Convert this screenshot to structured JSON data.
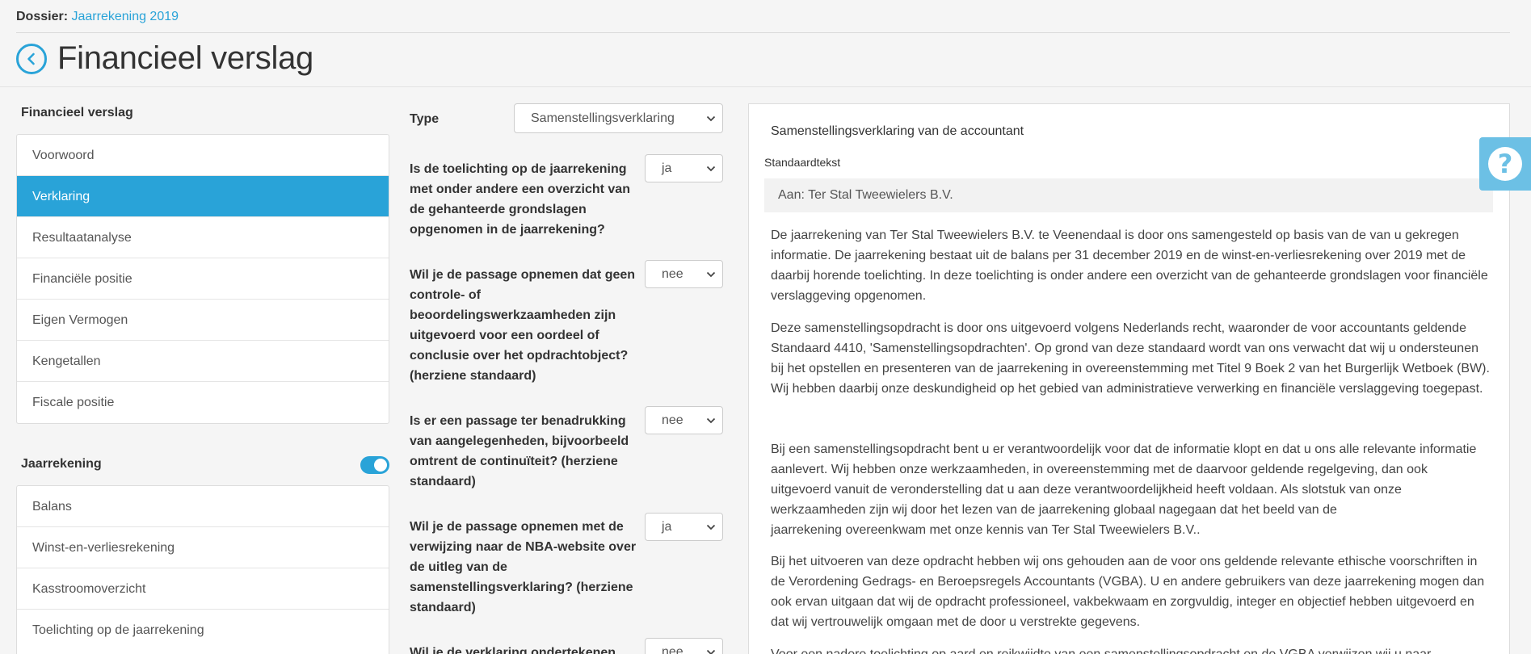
{
  "dossier": {
    "label": "Dossier:",
    "value": "Jaarrekening 2019"
  },
  "page": {
    "title": "Financieel verslag"
  },
  "sidebar": {
    "section1_title": "Financieel verslag",
    "section1_items": [
      {
        "label": "Voorwoord"
      },
      {
        "label": "Verklaring"
      },
      {
        "label": "Resultaatanalyse"
      },
      {
        "label": "Financiële positie"
      },
      {
        "label": "Eigen Vermogen"
      },
      {
        "label": "Kengetallen"
      },
      {
        "label": "Fiscale positie"
      }
    ],
    "section2_title": "Jaarrekening",
    "section2_items": [
      {
        "label": "Balans"
      },
      {
        "label": "Winst-en-verliesrekening"
      },
      {
        "label": "Kasstroomoverzicht"
      },
      {
        "label": "Toelichting op de jaarrekening"
      }
    ]
  },
  "form": {
    "type_label": "Type",
    "type_value": "Samenstellingsverklaring",
    "q1_label": "Is de toelichting op de jaarrekening met onder andere een overzicht van de gehanteerde grondslagen opgenomen in de jaarrekening?",
    "q1_value": "ja",
    "q2_label": "Wil je de passage opnemen dat geen controle- of beoordelingswerkzaamheden zijn uitgevoerd voor een oordeel of conclusie over het opdrachtobject? (herziene standaard)",
    "q2_value": "nee",
    "q3_label": "Is er een passage ter benadrukking van aangelegenheden, bijvoorbeeld omtrent de continuïteit? (herziene standaard)",
    "q3_value": "nee",
    "q4_label": "Wil je de passage opnemen met de verwijzing naar de NBA-website over de uitleg van de samenstellingsverklaring? (herziene standaard)",
    "q4_value": "ja",
    "q5_label": "Wil je de verklaring ondertekenen",
    "q5_value": "nee"
  },
  "panel": {
    "title": "Samenstellingsverklaring van de accountant",
    "std_label": "Standaardtekst",
    "aan": "Aan: Ter Stal Tweewielers B.V.",
    "p1": "De jaarrekening van Ter Stal Tweewielers B.V. te Veenendaal is door ons samengesteld op basis van de van u gekregen informatie. De jaarrekening bestaat uit de balans per 31 december 2019 en de winst-en-verliesrekening over 2019 met de daarbij horende toelichting. In deze toelichting is onder andere een overzicht van de gehanteerde grondslagen voor financiële verslaggeving opgenomen.",
    "p2": "Deze samenstellingsopdracht is door ons uitgevoerd volgens Nederlands recht, waaronder de voor accountants geldende Standaard 4410, 'Samenstellingsopdrachten'. Op grond van deze standaard wordt van ons verwacht dat wij u ondersteunen bij het opstellen en presenteren van de jaarrekening in overeenstemming met Titel 9 Boek 2 van het Burgerlijk Wetboek (BW). Wij hebben daarbij onze deskundigheid op het gebied van administratieve verwerking en financiële verslaggeving toegepast.",
    "p3a": "Bij een samenstellingsopdracht bent u er verantwoordelijk voor dat de informatie klopt en dat u ons alle relevante informatie aanlevert. Wij hebben onze werkzaamheden, in overeenstemming met de daarvoor geldende regelgeving, dan ook uitgevoerd vanuit de veronderstelling dat u aan deze verantwoordelijkheid heeft voldaan. Als slotstuk van onze werkzaamheden zijn wij door het lezen van de jaarrekening globaal nagegaan dat het beeld van de",
    "p3b": "jaarrekening overeenkwam met onze kennis van Ter Stal Tweewielers B.V..",
    "p4": "Bij het uitvoeren van deze opdracht hebben wij ons gehouden aan de voor ons geldende relevante ethische voorschriften in de Verordening Gedrags- en Beroepsregels Accountants (VGBA). U en andere gebruikers van deze jaarrekening mogen dan ook ervan uitgaan dat wij de opdracht professioneel, vakbekwaam en zorgvuldig, integer en objectief hebben uitgevoerd en dat wij vertrouwelijk omgaan met de door u verstrekte gegevens.",
    "p5": "Voor een nadere toelichting op aard en reikwijdte van een samenstellingsopdracht en de VGBA verwijzen wij u naar"
  },
  "help": {
    "icon": "?"
  },
  "colors": {
    "accent": "#29a3d8"
  }
}
